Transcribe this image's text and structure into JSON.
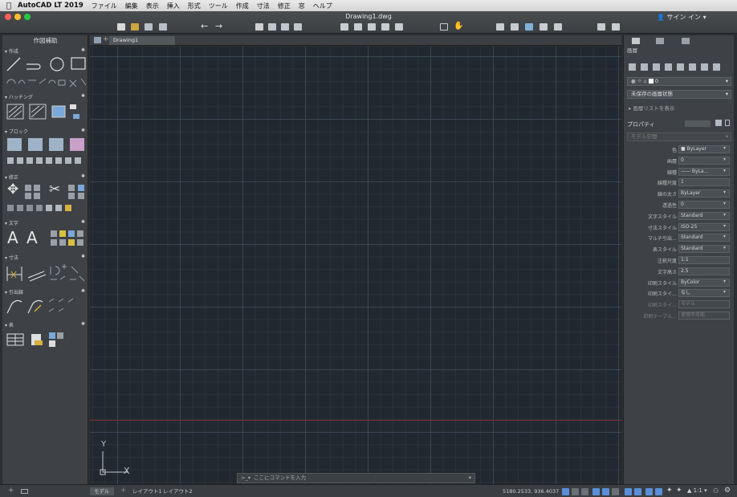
{
  "menubar": {
    "app_name": "AutoCAD LT 2019",
    "items": [
      "ファイル",
      "編集",
      "表示",
      "挿入",
      "形式",
      "ツール",
      "作成",
      "寸法",
      "修正",
      "窓",
      "ヘルプ"
    ]
  },
  "window": {
    "title": "Drawing1.dwg",
    "signin_label": "サイン イン",
    "traffic_colors": [
      "#ff5f57",
      "#febc2e",
      "#28c840"
    ]
  },
  "palette": {
    "title": "作図補助",
    "sections": [
      {
        "label": "作成"
      },
      {
        "label": "ハッチング"
      },
      {
        "label": "ブロック"
      },
      {
        "label": "修正"
      },
      {
        "label": "文字"
      },
      {
        "label": "寸法"
      },
      {
        "label": "引出線"
      },
      {
        "label": "表"
      }
    ],
    "text_tool_glyphs": [
      "A",
      "A"
    ]
  },
  "tabs": {
    "document_tab": "Drawing1",
    "layout_tabs": [
      "モデル",
      "レイアウト1",
      "レイアウト2"
    ]
  },
  "canvas": {
    "ucs_y": "Y",
    "ucs_x": "X",
    "command_placeholder": "ここにコマンドを入力"
  },
  "properties": {
    "layers_header": "画層",
    "layer_current": "0",
    "layer_state": "未保存の画層状態",
    "layer_list_link": "画層リストを表示",
    "properties_header": "プロパティ",
    "selection": "モデル空間",
    "rows": [
      {
        "label": "色",
        "value": "■ ByLayer",
        "dim": false
      },
      {
        "label": "画層",
        "value": "0",
        "dim": false
      },
      {
        "label": "線種",
        "value": "—— ByLa...",
        "dim": false
      },
      {
        "label": "線種尺度",
        "value": "1",
        "dim": false
      },
      {
        "label": "線の太さ",
        "value": "ByLayer",
        "dim": false
      },
      {
        "label": "透過性",
        "value": "0",
        "dim": false
      },
      {
        "label": "文字スタイル",
        "value": "Standard",
        "dim": false
      },
      {
        "label": "寸法スタイル",
        "value": "ISO-25",
        "dim": false
      },
      {
        "label": "マルチ引出…",
        "value": "Standard",
        "dim": false
      },
      {
        "label": "表スタイル",
        "value": "Standard",
        "dim": false
      },
      {
        "label": "注釈尺度",
        "value": "1:1",
        "dim": false
      },
      {
        "label": "文字高さ",
        "value": "2.5",
        "dim": false
      },
      {
        "label": "印刷スタイル",
        "value": "ByColor",
        "dim": false
      },
      {
        "label": "印刷スタイ…",
        "value": "なし",
        "dim": false
      },
      {
        "label": "印刷スタイ…",
        "value": "モデル",
        "dim": true
      },
      {
        "label": "印刷テーブル…",
        "value": "使用不可能",
        "dim": true
      }
    ]
  },
  "status": {
    "coordinates": "5180.2533, 936.4037",
    "scale": "1:1"
  },
  "colors": {
    "accent_blue": "#5a8fd8",
    "canvas_bg": "#212830",
    "panel_bg": "#3e4246"
  }
}
